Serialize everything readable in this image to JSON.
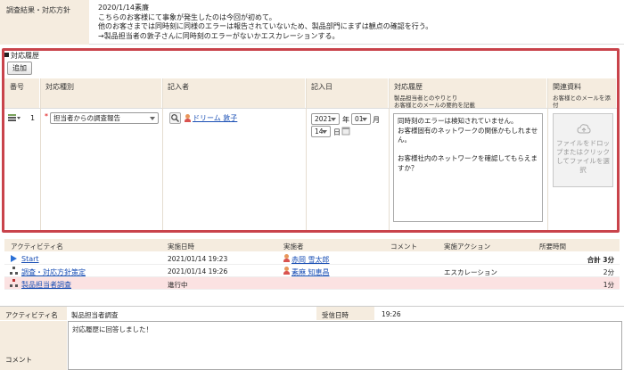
{
  "result": {
    "label": "調査結果・対応方針",
    "lines": [
      "2020/1/14素廉",
      "こちらのお客様にて事象が発生したのは今回が初めて。",
      "他のお客さまでは同時刻に同様のエラーは報告されていないため、製品部門にまずは観点の確認を行う。",
      "→製品担当者の敦子さんに同時刻のエラーがないかエスカレーションする。"
    ]
  },
  "history": {
    "title": "対応履歴",
    "add_label": "追加",
    "headers": {
      "number": "番号",
      "type": "対応種別",
      "writer": "記入者",
      "date": "記入日",
      "record": "対応履歴",
      "record_sub1": "製品担当者とのやりとり",
      "record_sub2": "お客様とのメールの要約を記載",
      "attach": "関連資料",
      "attach_sub": "お客様とのメールを添付"
    },
    "row": {
      "number": "1",
      "required_mark": "*",
      "type_value": "担当者からの調査報告",
      "writer_name": "ドリーム 敦子",
      "year": "2021",
      "year_unit": "年",
      "month": "01",
      "month_unit": "月",
      "day": "14",
      "day_unit": "日",
      "record_text": "同時刻のエラーは検知されていません。\nお客様固有のネットワークの関係かもしれません。\n\nお客様社内のネットワークを確認してもらえますか？",
      "drop_text": "ファイルをドロップまたはクリックしてファイルを選択"
    }
  },
  "activity": {
    "headers": {
      "name": "アクティビティ名",
      "date": "実施日時",
      "actor": "実施者",
      "comment": "コメント",
      "action": "実施アクション",
      "time": "所要時間"
    },
    "rows": [
      {
        "name": "Start",
        "date": "2021/01/14 19:23",
        "actor": "赤岡 雪太郎",
        "comment": "",
        "action": "",
        "time": "合計 3分"
      },
      {
        "name": "調査・対応方針策定",
        "date": "2021/01/14 19:26",
        "actor": "素麻 知恵昌",
        "comment": "",
        "action": "エスカレーション",
        "time": "2分"
      },
      {
        "name": "製品担当者調査",
        "date": "進行中",
        "actor": "",
        "comment": "",
        "action": "",
        "time": "1分"
      }
    ]
  },
  "form": {
    "activity_label": "アクティビティ名",
    "activity_value": "製品担当者調査",
    "received_label": "受信日時",
    "received_value": "19:26",
    "comment_label": "コメント",
    "comment_value": "対応履歴に回答しました！"
  }
}
